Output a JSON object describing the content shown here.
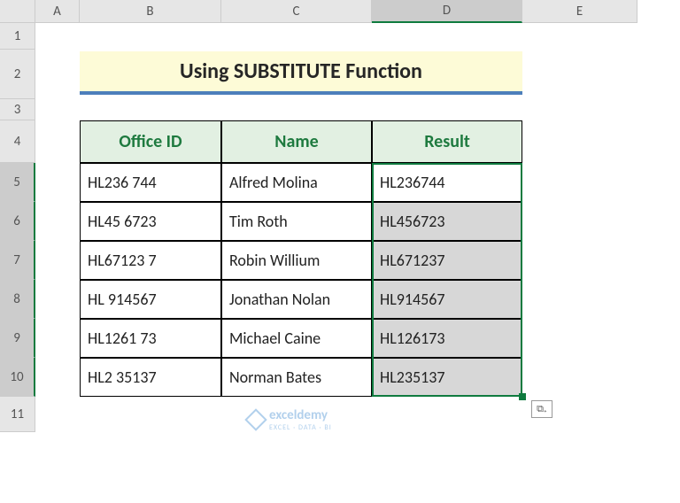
{
  "columns": [
    "A",
    "B",
    "C",
    "D",
    "E"
  ],
  "rows": [
    "1",
    "2",
    "3",
    "4",
    "5",
    "6",
    "7",
    "8",
    "9",
    "10",
    "11"
  ],
  "selected_column_index": 3,
  "selected_row_start": 5,
  "selected_row_end": 10,
  "title": "Using SUBSTITUTE Function",
  "table": {
    "headers": [
      "Office ID",
      "Name",
      "Result"
    ],
    "rows": [
      {
        "office_id": "HL236 744",
        "name": "Alfred Molina",
        "result": "HL236744"
      },
      {
        "office_id": "HL45 6723",
        "name": "Tim Roth",
        "result": "HL456723"
      },
      {
        "office_id": "HL67123 7",
        "name": "Robin Willium",
        "result": "HL671237"
      },
      {
        "office_id": "HL 914567",
        "name": "Jonathan Nolan",
        "result": "HL914567"
      },
      {
        "office_id": "HL1261 73",
        "name": "Michael Caine",
        "result": "HL126173"
      },
      {
        "office_id": "HL2 35137",
        "name": "Norman Bates",
        "result": "HL235137"
      }
    ]
  },
  "watermark": {
    "brand": "exceldemy",
    "tagline": "EXCEL · DATA · BI"
  },
  "autofill_glyph": "⧉₊",
  "chart_data": {
    "type": "table",
    "title": "Using SUBSTITUTE Function",
    "columns": [
      "Office ID",
      "Name",
      "Result"
    ],
    "rows": [
      [
        "HL236 744",
        "Alfred Molina",
        "HL236744"
      ],
      [
        "HL45 6723",
        "Tim Roth",
        "HL456723"
      ],
      [
        "HL67123 7",
        "Robin Willium",
        "HL671237"
      ],
      [
        "HL 914567",
        "Jonathan Nolan",
        "HL914567"
      ],
      [
        "HL1261 73",
        "Michael Caine",
        "HL126173"
      ],
      [
        "HL2 35137",
        "Norman Bates",
        "HL235137"
      ]
    ]
  }
}
